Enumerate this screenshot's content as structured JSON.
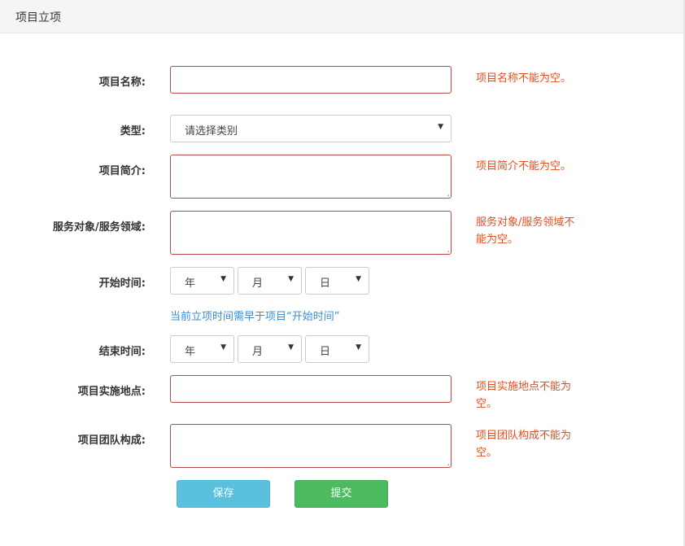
{
  "header": {
    "title": "项目立项"
  },
  "form": {
    "name": {
      "label": "项目名称:",
      "value": "",
      "error": "项目名称不能为空。"
    },
    "type": {
      "label": "类型:",
      "selected": "请选择类别"
    },
    "intro": {
      "label": "项目简介:",
      "value": "",
      "error": "项目简介不能为空。"
    },
    "service": {
      "label": "服务对象/服务领域:",
      "value": "",
      "error": "服务对象/服务领域不能为空。"
    },
    "start_time": {
      "label": "开始时间:",
      "year": "年",
      "month": "月",
      "day": "日"
    },
    "hint": "当前立项时间需早于项目“开始时间”",
    "end_time": {
      "label": "结束时间:",
      "year": "年",
      "month": "月",
      "day": "日"
    },
    "location": {
      "label": "项目实施地点:",
      "value": "",
      "error": "项目实施地点不能为空。"
    },
    "team": {
      "label": "项目团队构成:",
      "value": "",
      "error": "项目团队构成不能为空。"
    }
  },
  "buttons": {
    "save": "保存",
    "submit": "提交"
  },
  "colors": {
    "error": "#e74c1d",
    "hint": "#3a8ed6",
    "save": "#5bc0de",
    "submit": "#4cbb5f",
    "invalid_border": "#b94a48"
  }
}
